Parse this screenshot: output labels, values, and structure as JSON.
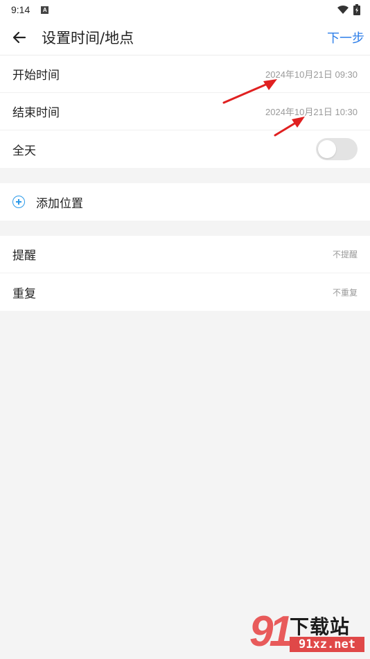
{
  "status_bar": {
    "time": "9:14",
    "notification_icon": "a-icon",
    "wifi_icon": "wifi-icon",
    "battery_icon": "battery-icon"
  },
  "app_bar": {
    "back_icon": "arrow-left-icon",
    "title": "设置时间/地点",
    "next_label": "下一步"
  },
  "time_section": {
    "start": {
      "label": "开始时间",
      "value": "2024年10月21日 09:30"
    },
    "end": {
      "label": "结束时间",
      "value": "2024年10月21日 10:30"
    },
    "all_day": {
      "label": "全天",
      "enabled": false
    }
  },
  "location_section": {
    "add_icon": "plus-circle-icon",
    "label": "添加位置"
  },
  "options_section": {
    "reminder": {
      "label": "提醒",
      "value": "不提醒"
    },
    "repeat": {
      "label": "重复",
      "value": "不重复"
    }
  },
  "watermark": {
    "logo": "91",
    "title": "下载站",
    "url": "91xz.net"
  },
  "colors": {
    "accent": "#2b7de9",
    "annotation_arrow": "#e02020",
    "background": "#f4f4f4"
  }
}
